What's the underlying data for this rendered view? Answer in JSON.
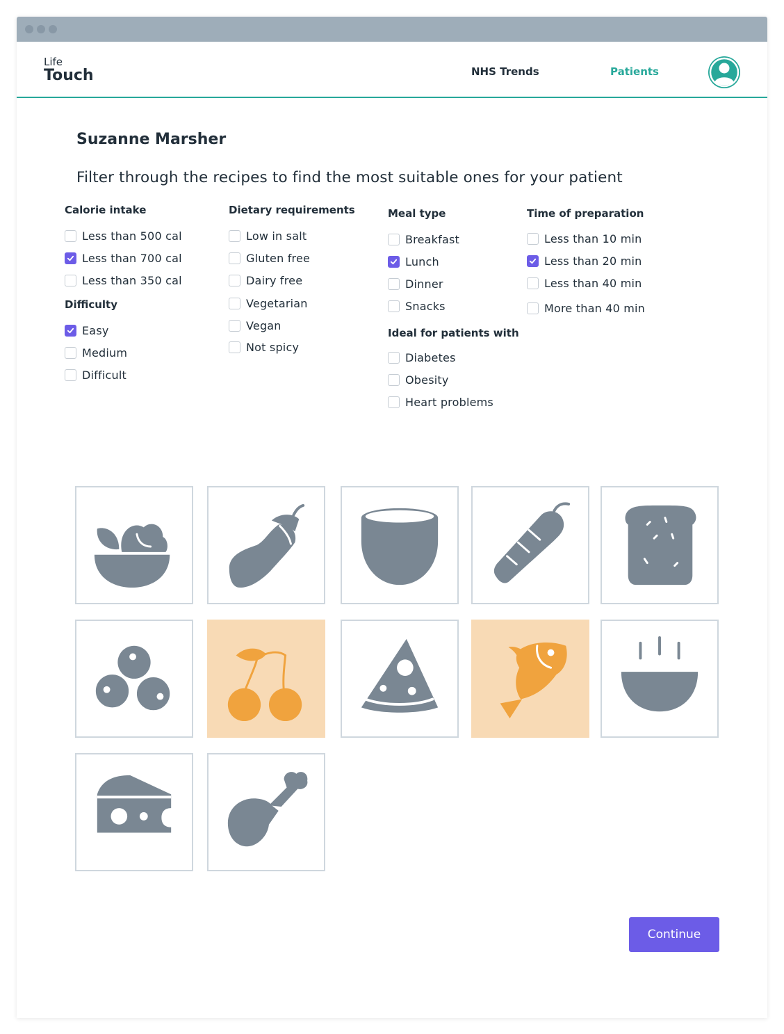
{
  "app": {
    "logo_top": "Life",
    "logo_bottom": "Touch"
  },
  "nav": {
    "trends": "NHS Trends",
    "patients": "Patients",
    "active": "Patients"
  },
  "colors": {
    "accent": "#27a89a",
    "primary": "#6c5ce7",
    "icon": "#7a8793",
    "selected_icon": "#f0a33e",
    "selected_bg": "#f8dab5"
  },
  "patient": {
    "name": "Suzanne Marsher"
  },
  "instructions": "Filter through the recipes to find the most suitable ones for your patient",
  "filters": {
    "calorie": {
      "title": "Calorie intake",
      "options": [
        {
          "label": "Less than 500 cal",
          "checked": false
        },
        {
          "label": "Less than 700 cal",
          "checked": true
        },
        {
          "label": "Less than 350 cal",
          "checked": false
        }
      ]
    },
    "difficulty": {
      "title": "Difficulty",
      "options": [
        {
          "label": "Easy",
          "checked": true
        },
        {
          "label": "Medium",
          "checked": false
        },
        {
          "label": "Difficult",
          "checked": false
        }
      ]
    },
    "dietary": {
      "title": "Dietary requirements",
      "options": [
        {
          "label": "Low in salt",
          "checked": false
        },
        {
          "label": "Gluten free",
          "checked": false
        },
        {
          "label": "Dairy free",
          "checked": false
        },
        {
          "label": "Vegetarian",
          "checked": false
        },
        {
          "label": "Vegan",
          "checked": false
        },
        {
          "label": "Not spicy",
          "checked": false
        }
      ]
    },
    "meal": {
      "title": "Meal type",
      "options": [
        {
          "label": "Breakfast",
          "checked": false
        },
        {
          "label": "Lunch",
          "checked": true
        },
        {
          "label": "Dinner",
          "checked": false
        },
        {
          "label": "Snacks",
          "checked": false
        }
      ]
    },
    "ideal": {
      "title": "Ideal for patients with",
      "options": [
        {
          "label": "Diabetes",
          "checked": false
        },
        {
          "label": "Obesity",
          "checked": false
        },
        {
          "label": "Heart problems",
          "checked": false
        }
      ]
    },
    "time": {
      "title": "Time of preparation",
      "options": [
        {
          "label": "Less than 10 min",
          "checked": false
        },
        {
          "label": "Less than 20 min",
          "checked": true
        },
        {
          "label": "Less than 40 min",
          "checked": false
        },
        {
          "label": "More than 40 min",
          "checked": false
        }
      ]
    }
  },
  "food_tiles": [
    {
      "icon": "salad-bowl-icon",
      "selected": false
    },
    {
      "icon": "eggplant-icon",
      "selected": false
    },
    {
      "icon": "bowl-icon",
      "selected": false
    },
    {
      "icon": "carrot-icon",
      "selected": false
    },
    {
      "icon": "bread-slice-icon",
      "selected": false
    },
    {
      "icon": "blueberries-icon",
      "selected": false
    },
    {
      "icon": "cherries-icon",
      "selected": true
    },
    {
      "icon": "pizza-slice-icon",
      "selected": false
    },
    {
      "icon": "fish-icon",
      "selected": true
    },
    {
      "icon": "soup-bowl-icon",
      "selected": false
    },
    {
      "icon": "cheese-icon",
      "selected": false
    },
    {
      "icon": "chicken-leg-icon",
      "selected": false
    }
  ],
  "continue_label": "Continue"
}
